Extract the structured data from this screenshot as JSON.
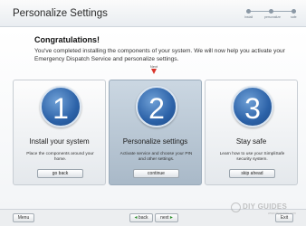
{
  "header": {
    "title": "Personalize Settings",
    "progress_steps": [
      "Install",
      "personalize",
      "safe"
    ]
  },
  "intro": {
    "title": "Congratulations!",
    "body": "You've completed installing the components of your system.  We will now help you activate your Emergency Dispatch Service and personalize settings."
  },
  "next_marker": "Next",
  "cards": [
    {
      "number": "1",
      "title": "Install your system",
      "desc": "Place the components around your home.",
      "button": "go back"
    },
    {
      "number": "2",
      "title": "Personalize settings",
      "desc": "Activate service and choose your PIN and other settings.",
      "button": "continue"
    },
    {
      "number": "3",
      "title": "Stay safe",
      "desc": "Learn how to use your SimpliSafe security system.",
      "button": "skip ahead"
    }
  ],
  "footer": {
    "menu": "Menu",
    "back": "back",
    "next": "next",
    "exit": "Exit"
  },
  "watermark": {
    "brand": "DIY GUIDES",
    "sub": "www.diyguides.com"
  }
}
